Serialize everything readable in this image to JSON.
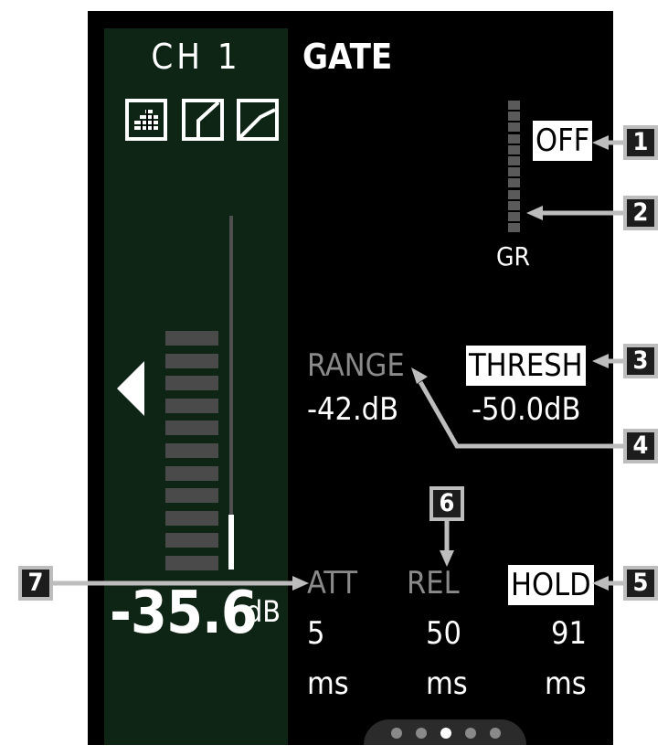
{
  "channel": {
    "label": "CH 1",
    "level_value": "-35.6",
    "level_unit": "dB"
  },
  "gate": {
    "title": "GATE",
    "state": "OFF",
    "gr_label": "GR",
    "range": {
      "label": "RANGE",
      "value": "-42.dB"
    },
    "threshold": {
      "label": "THRESH",
      "value": "-50.0dB"
    },
    "attack": {
      "label": "ATT",
      "value": "5",
      "unit": "ms"
    },
    "release": {
      "label": "REL",
      "value": "50",
      "unit": "ms"
    },
    "hold": {
      "label": "HOLD",
      "value": "91",
      "unit": "ms"
    }
  },
  "callouts": [
    "1",
    "2",
    "3",
    "4",
    "5",
    "6",
    "7"
  ],
  "pager": {
    "pages": 5,
    "active": 3
  }
}
